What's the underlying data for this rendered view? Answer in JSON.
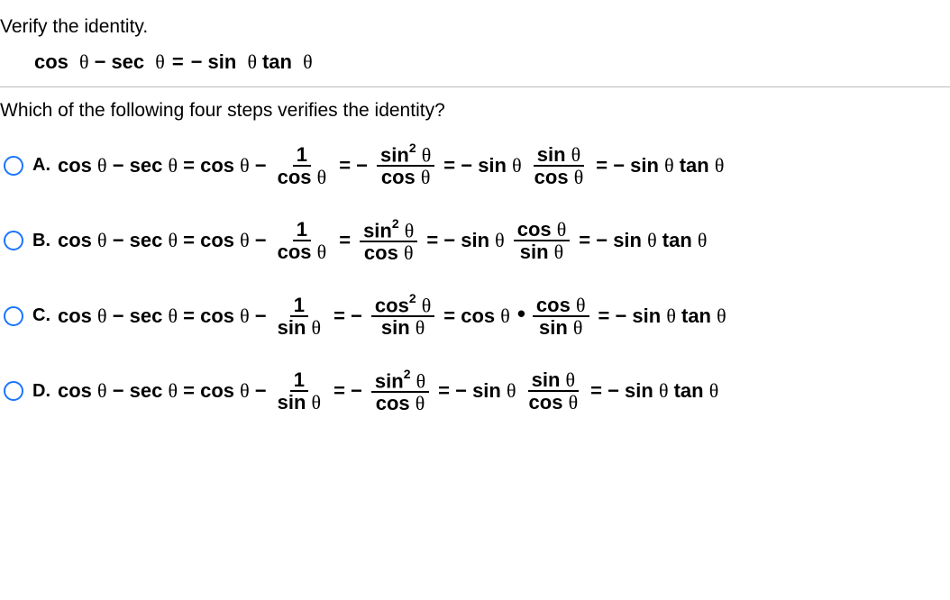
{
  "prompt": "Verify the identity.",
  "identity": "cos θ − sec θ = − sin θ tan θ",
  "question": "Which of the following four steps verifies the identity?",
  "options": {
    "A": {
      "letter": "A.",
      "start": "cos θ − sec θ = cos θ −",
      "frac1_num": "1",
      "frac1_den": "cos θ",
      "eq1": "= −",
      "frac2_num_a": "sin",
      "frac2_num_sup": "2",
      "frac2_num_b": "θ",
      "frac2_den": "cos θ",
      "eq2": "= − sin θ",
      "frac3_num": "sin θ",
      "frac3_den": "cos θ",
      "end": "= − sin θ tan θ"
    },
    "B": {
      "letter": "B.",
      "start": "cos θ − sec θ = cos θ −",
      "frac1_num": "1",
      "frac1_den": "cos θ",
      "eq1": "=",
      "frac2_num_a": "sin",
      "frac2_num_sup": "2",
      "frac2_num_b": "θ",
      "frac2_den": "cos θ",
      "eq2": "= − sin θ",
      "frac3_num": "cos θ",
      "frac3_den": "sin θ",
      "end": "= − sin θ tan θ"
    },
    "C": {
      "letter": "C.",
      "start": "cos θ − sec θ = cos θ −",
      "frac1_num": "1",
      "frac1_den": "sin θ",
      "eq1": "= −",
      "frac2_num_a": "cos",
      "frac2_num_sup": "2",
      "frac2_num_b": "θ",
      "frac2_den": "sin θ",
      "eq2": "= cos θ",
      "dot": "•",
      "frac3_num": "cos θ",
      "frac3_den": "sin θ",
      "end": "= − sin θ tan θ"
    },
    "D": {
      "letter": "D.",
      "start": "cos θ − sec θ = cos θ −",
      "frac1_num": "1",
      "frac1_den": "sin θ",
      "eq1": "= −",
      "frac2_num_a": "sin",
      "frac2_num_sup": "2",
      "frac2_num_b": "θ",
      "frac2_den": "cos θ",
      "eq2": "= − sin θ",
      "frac3_num": "sin θ",
      "frac3_den": "cos θ",
      "end": "= − sin θ tan θ"
    }
  }
}
